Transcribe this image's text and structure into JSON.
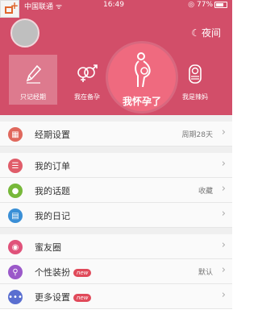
{
  "status_bar": {
    "carrier": "中国联通 ᯤ",
    "time": "16:49",
    "battery": "◎ 77%"
  },
  "header": {
    "night_mode_label": "夜间"
  },
  "modes": [
    {
      "label": "只记经期"
    },
    {
      "label": "我在备孕"
    },
    {
      "label": "我怀孕了"
    },
    {
      "label": "我是辣妈"
    }
  ],
  "rows": {
    "period_settings": {
      "label": "经期设置",
      "value": "周期28天"
    },
    "orders": {
      "label": "我的订单"
    },
    "topics": {
      "label": "我的话题",
      "value": "收藏"
    },
    "diary": {
      "label": "我的日记"
    },
    "friends": {
      "label": "蜜友圈"
    },
    "themes": {
      "label": "个性装扮",
      "badge": "new",
      "value": "默认"
    },
    "more": {
      "label": "更多设置",
      "badge": "new"
    }
  },
  "colors": {
    "header_bg": "#d24e69",
    "circle": "#ef6a7f",
    "badge": "#e04a5a"
  }
}
